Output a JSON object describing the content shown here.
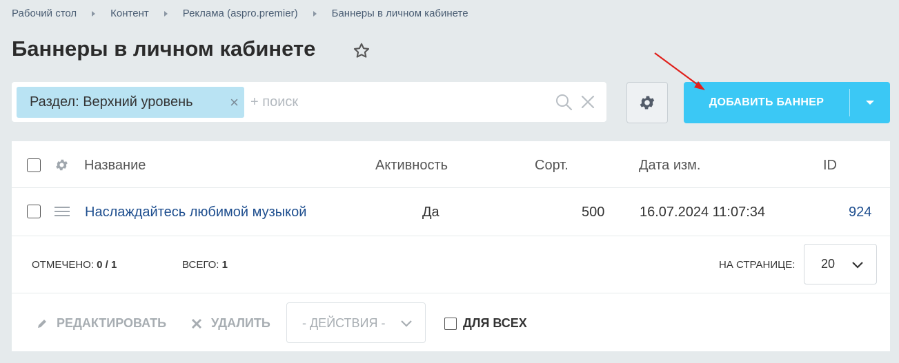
{
  "breadcrumb": [
    "Рабочий стол",
    "Контент",
    "Реклама (aspro.premier)",
    "Баннеры в личном кабинете"
  ],
  "page_title": "Баннеры в личном кабинете",
  "filter": {
    "chip_label": "Раздел: Верхний уровень",
    "search_placeholder": "+ поиск"
  },
  "toolbar": {
    "add_label": "ДОБАВИТЬ БАННЕР"
  },
  "table": {
    "headers": {
      "name": "Название",
      "active": "Активность",
      "sort": "Сорт.",
      "date": "Дата изм.",
      "id": "ID"
    },
    "rows": [
      {
        "name": "Наслаждайтесь любимой музыкой",
        "active": "Да",
        "sort": "500",
        "date": "16.07.2024 11:07:34",
        "id": "924"
      }
    ]
  },
  "footer": {
    "selected_label": "ОТМЕЧЕНО:",
    "selected_value": "0 / 1",
    "total_label": "ВСЕГО:",
    "total_value": "1",
    "per_page_label": "НА СТРАНИЦЕ:",
    "per_page_value": "20"
  },
  "actions": {
    "edit": "РЕДАКТИРОВАТЬ",
    "delete": "УДАЛИТЬ",
    "select": "- ДЕЙСТВИЯ -",
    "for_all": "ДЛЯ ВСЕХ"
  },
  "colors": {
    "accent": "#3bc8f5",
    "chip": "#b9e3f3",
    "link": "#1f4f8f",
    "annotation_arrow": "#e0201b"
  }
}
